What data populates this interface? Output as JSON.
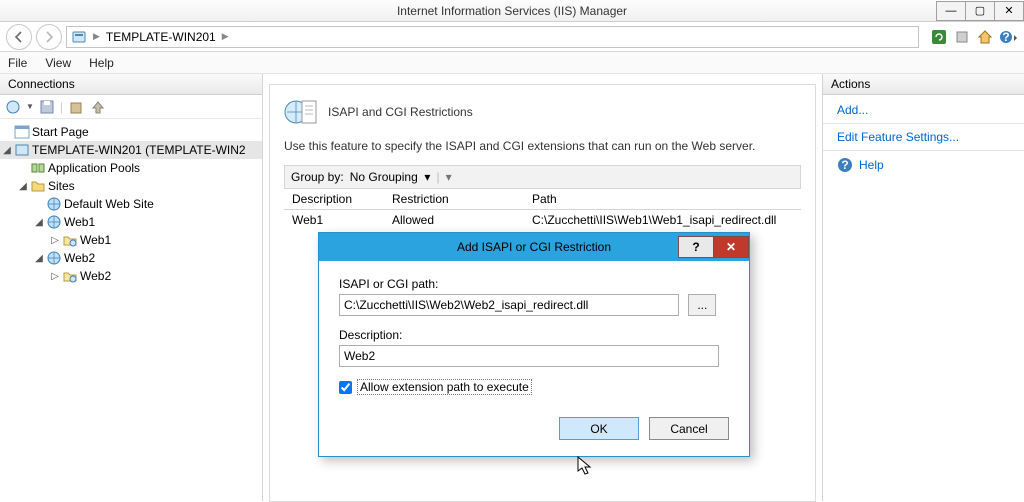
{
  "window": {
    "title": "Internet Information Services (IIS) Manager"
  },
  "breadcrumb": {
    "node": "TEMPLATE-WIN201"
  },
  "menu": {
    "file": "File",
    "view": "View",
    "help": "Help"
  },
  "panels": {
    "connections": "Connections",
    "actions": "Actions"
  },
  "tree": {
    "start": "Start Page",
    "server": "TEMPLATE-WIN201 (TEMPLATE-WIN2",
    "apppools": "Application Pools",
    "sites": "Sites",
    "defaultsite": "Default Web Site",
    "web1": "Web1",
    "web1app": "Web1",
    "web2": "Web2",
    "web2app": "Web2"
  },
  "page": {
    "title": "ISAPI and CGI Restrictions",
    "desc": "Use this feature to specify the ISAPI and CGI extensions that can run on the Web server.",
    "groupby_label": "Group by:",
    "groupby_value": "No Grouping",
    "cols": {
      "desc": "Description",
      "rest": "Restriction",
      "path": "Path"
    },
    "rows": [
      {
        "desc": "Web1",
        "rest": "Allowed",
        "path": "C:\\Zucchetti\\IIS\\Web1\\Web1_isapi_redirect.dll"
      }
    ]
  },
  "actions": {
    "add": "Add...",
    "edit": "Edit Feature Settings...",
    "help": "Help"
  },
  "dialog": {
    "title": "Add ISAPI or CGI Restriction",
    "path_label": "ISAPI or CGI path:",
    "path_value": "C:\\Zucchetti\\IIS\\Web2\\Web2_isapi_redirect.dll",
    "desc_label": "Description:",
    "desc_value": "Web2",
    "browse": "...",
    "allow": "Allow extension path to execute",
    "ok": "OK",
    "cancel": "Cancel"
  }
}
